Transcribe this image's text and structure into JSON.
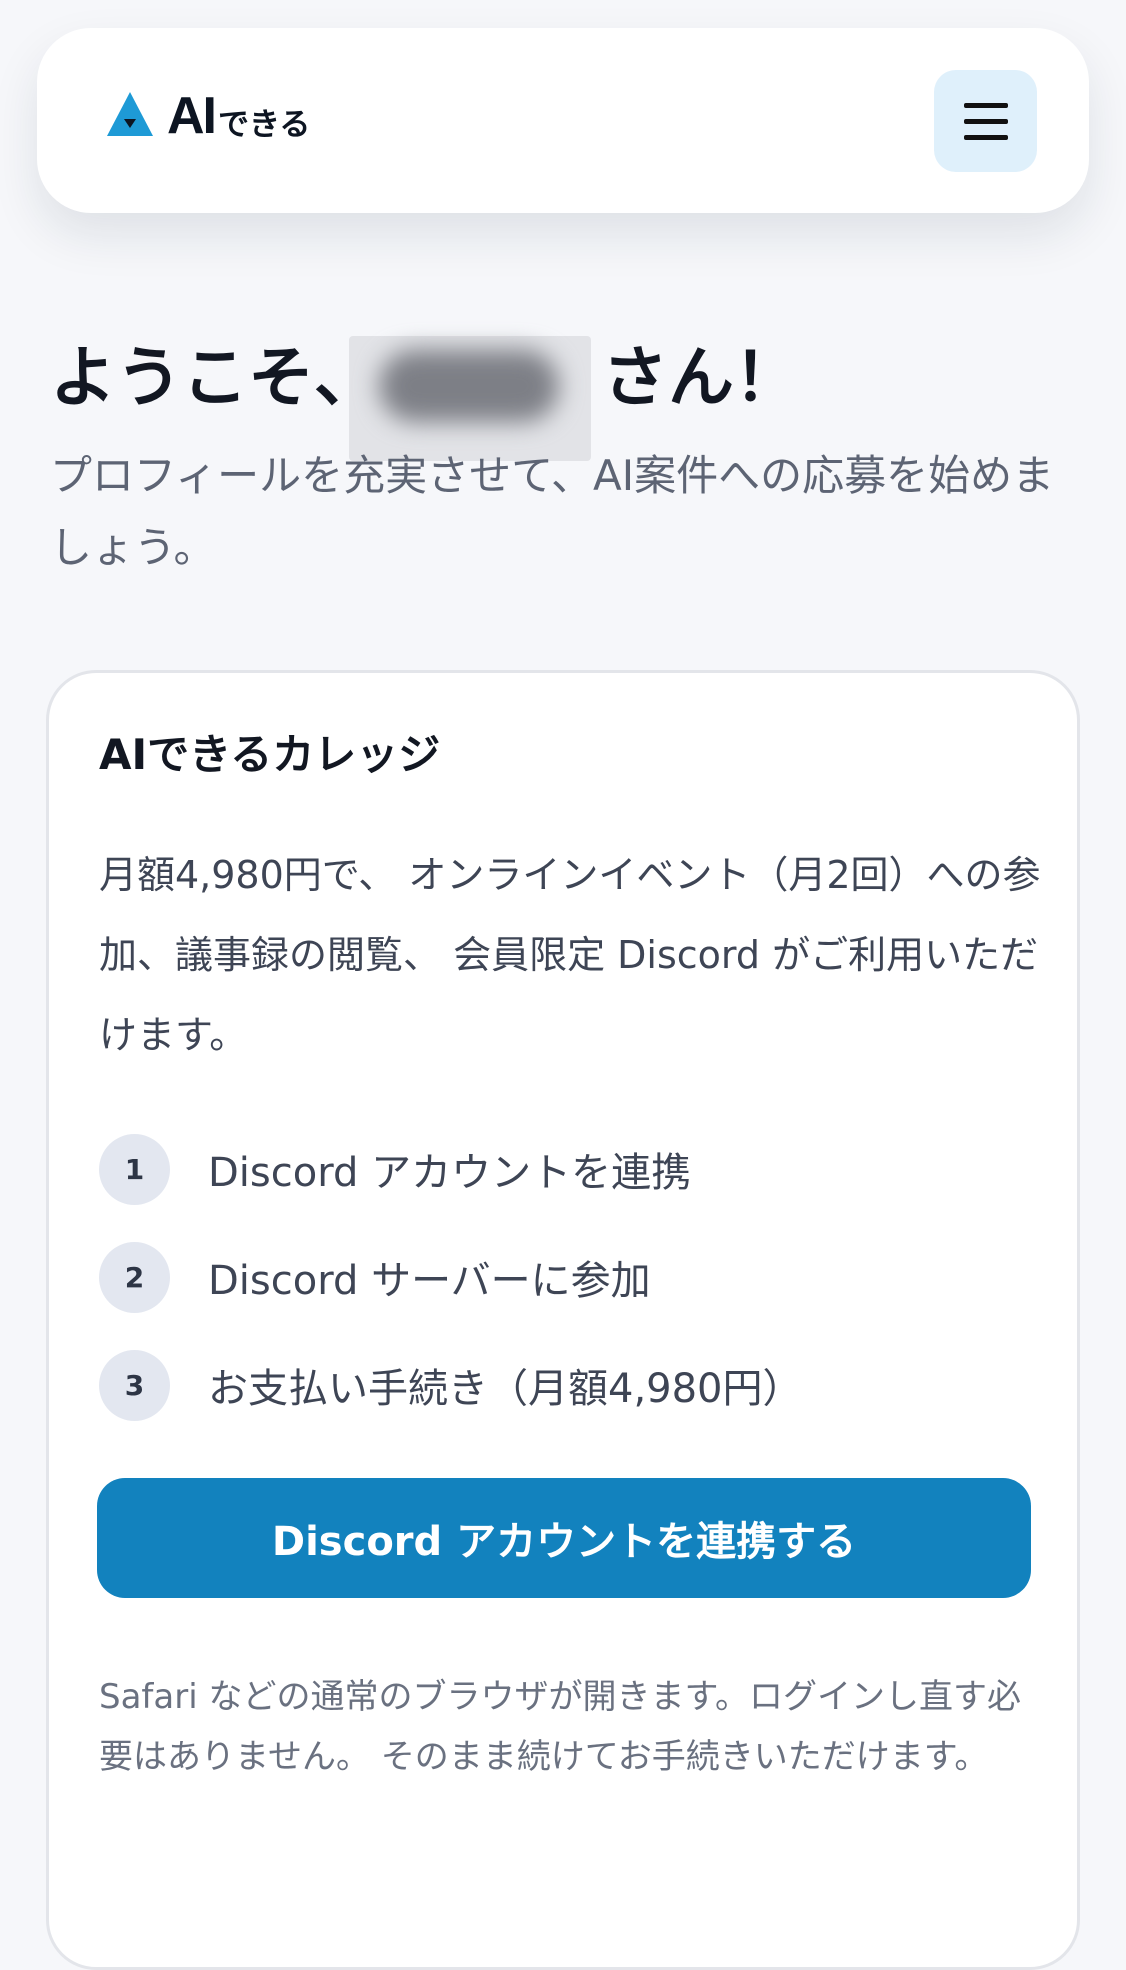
{
  "header": {
    "logo": {
      "mark_icon": "triangle-logo-icon",
      "text_main": "AI",
      "text_sub": "できる"
    },
    "menu_icon": "hamburger-menu-icon"
  },
  "welcome": {
    "greeting_prefix": "ようこそ、",
    "greeting_suffix": "さん！",
    "subtitle": "プロフィールを充実させて、AI案件への応募を始めましょう。"
  },
  "card": {
    "title": "AIできるカレッジ",
    "description": "月額4,980円で、 オンラインイベント（月2回）への参加、議事録の閲覧、 会員限定 Discord がご利用いただけます。",
    "steps": [
      {
        "number": "1",
        "label": "Discord アカウントを連携"
      },
      {
        "number": "2",
        "label": "Discord サーバーに参加"
      },
      {
        "number": "3",
        "label": "お支払い手続き（月額4,980円）"
      }
    ],
    "cta_label": "Discord アカウントを連携する",
    "note": "Safari などの通常のブラウザが開きます。ログインし直す必要はありません。 そのまま続けてお手続きいただけます。"
  },
  "colors": {
    "primary": "#1282be",
    "logo_accent": "#1e9ad6",
    "menu_bg": "#dff0fb",
    "page_bg": "#f6f7fa"
  }
}
